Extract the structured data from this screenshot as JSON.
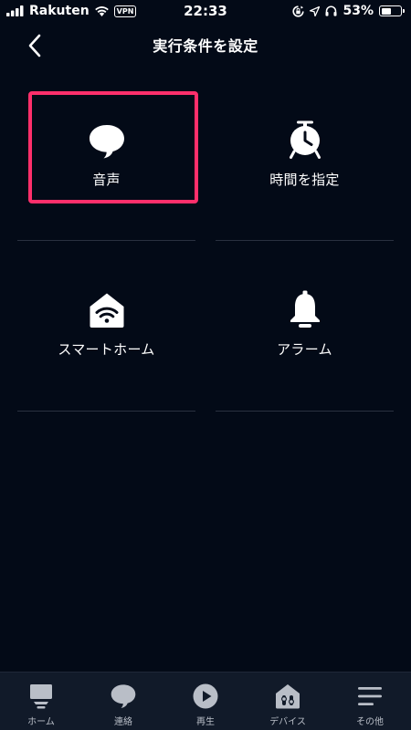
{
  "status_bar": {
    "carrier": "Rakuten",
    "vpn": "VPN",
    "time": "22:33",
    "battery": "53%",
    "battery_level": 0.53,
    "icons": [
      "signal-icon",
      "wifi-icon",
      "rotation-lock-icon",
      "location-icon",
      "headphones-icon",
      "battery-icon"
    ]
  },
  "header": {
    "title": "実行条件を設定",
    "back_icon": "chevron-left-icon"
  },
  "options": [
    {
      "label": "音声",
      "icon": "speech-bubble-icon",
      "highlighted": true
    },
    {
      "label": "時間を指定",
      "icon": "alarm-clock-icon",
      "highlighted": false
    },
    {
      "label": "スマートホーム",
      "icon": "smart-home-icon",
      "highlighted": false
    },
    {
      "label": "アラーム",
      "icon": "bell-icon",
      "highlighted": false
    }
  ],
  "colors": {
    "background": "#030a17",
    "highlight": "#ff2f6b",
    "nav_background": "#111a29"
  },
  "bottom_nav": [
    {
      "label": "ホーム",
      "icon": "home-icon"
    },
    {
      "label": "連絡",
      "icon": "chat-icon"
    },
    {
      "label": "再生",
      "icon": "play-icon"
    },
    {
      "label": "デバイス",
      "icon": "devices-icon"
    },
    {
      "label": "その他",
      "icon": "menu-icon"
    }
  ]
}
